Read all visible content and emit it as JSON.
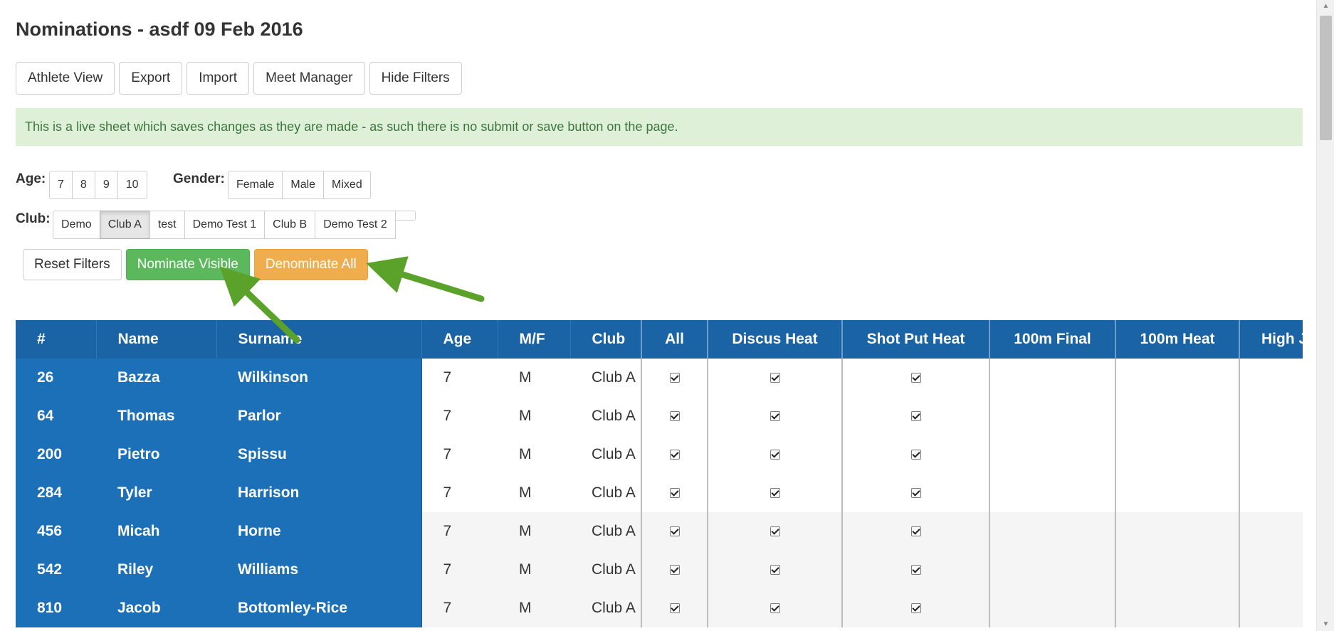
{
  "page": {
    "title": "Nominations - asdf 09 Feb 2016"
  },
  "toolbar": {
    "buttons": [
      "Athlete View",
      "Export",
      "Import",
      "Meet Manager",
      "Hide Filters"
    ]
  },
  "notice": "This is a live sheet which saves changes as they are made - as such there is no submit or save button on the page.",
  "filters": {
    "age": {
      "label": "Age:",
      "options": [
        "7",
        "8",
        "9",
        "10"
      ]
    },
    "gender": {
      "label": "Gender:",
      "options": [
        "Female",
        "Male",
        "Mixed"
      ]
    },
    "club": {
      "label": "Club:",
      "options": [
        "Demo",
        "Club A",
        "test",
        "Demo Test 1",
        "Club B",
        "Demo Test 2",
        ""
      ],
      "selected": "Club A"
    }
  },
  "actions": {
    "reset": "Reset Filters",
    "nominate": "Nominate Visible",
    "denominate": "Denominate All"
  },
  "table": {
    "headers": [
      "#",
      "Name",
      "Surname",
      "Age",
      "M/F",
      "Club",
      "All",
      "Discus Heat",
      "Shot Put Heat",
      "100m Final",
      "100m Heat",
      "High Jump"
    ],
    "rows": [
      {
        "num": "26",
        "name": "Bazza",
        "surname": "Wilkinson",
        "age": "7",
        "mf": "M",
        "club": "Club A"
      },
      {
        "num": "64",
        "name": "Thomas",
        "surname": "Parlor",
        "age": "7",
        "mf": "M",
        "club": "Club A"
      },
      {
        "num": "200",
        "name": "Pietro",
        "surname": "Spissu",
        "age": "7",
        "mf": "M",
        "club": "Club A"
      },
      {
        "num": "284",
        "name": "Tyler",
        "surname": "Harrison",
        "age": "7",
        "mf": "M",
        "club": "Club A"
      },
      {
        "num": "456",
        "name": "Micah",
        "surname": "Horne",
        "age": "7",
        "mf": "M",
        "club": "Club A"
      },
      {
        "num": "542",
        "name": "Riley",
        "surname": "Williams",
        "age": "7",
        "mf": "M",
        "club": "Club A"
      },
      {
        "num": "810",
        "name": "Jacob",
        "surname": "Bottomley-Rice",
        "age": "7",
        "mf": "M",
        "club": "Club A"
      }
    ]
  },
  "colors": {
    "header_bg": "#1a64a6",
    "frozen_bg": "#1c70b8",
    "success": "#5cb85c",
    "warning": "#f0ad4e",
    "notice_bg": "#dff0d8",
    "annotation_arrow": "#5aa22a"
  }
}
